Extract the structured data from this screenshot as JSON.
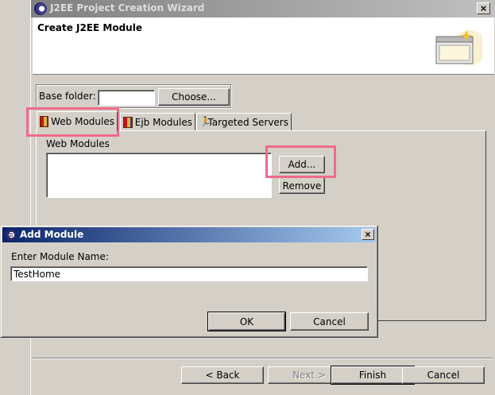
{
  "wizard": {
    "title": "J2EE Project Creation Wizard",
    "close_label": "×",
    "header_title": "Create J2EE Module",
    "base_folder_label": "Base folder:",
    "base_folder_value": "",
    "choose_label": "Choose...",
    "tabs": [
      {
        "label": "Web Modules",
        "icon": "web-modules-icon",
        "active": true
      },
      {
        "label": "Ejb Modules",
        "icon": "ejb-modules-icon",
        "active": false
      },
      {
        "label": "Targeted Servers",
        "icon": "targeted-servers-icon",
        "active": false
      }
    ],
    "panel_label": "Web Modules",
    "add_label": "Add...",
    "remove_label": "Remove",
    "back_label": "< Back",
    "next_label": "Next >",
    "finish_label": "Finish",
    "cancel_label": "Cancel"
  },
  "dialog": {
    "title": "Add Module",
    "close_label": "×",
    "prompt": "Enter Module Name:",
    "value": "TestHome",
    "ok_label": "OK",
    "cancel_label": "Cancel"
  },
  "colors": {
    "highlight": "#f06a8a",
    "dialog_title_start": "#0a246a",
    "dialog_title_end": "#a6caf0",
    "face": "#d4d0c8"
  }
}
